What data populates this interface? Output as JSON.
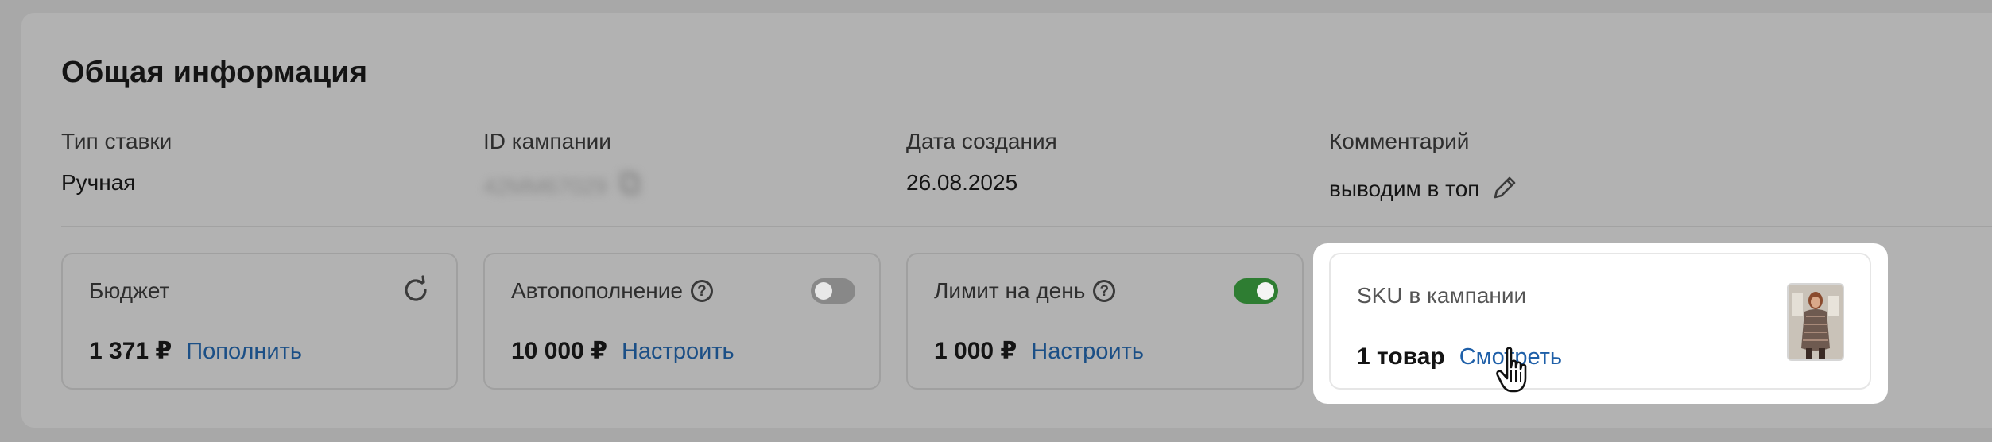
{
  "section": {
    "title": "Общая информация"
  },
  "info": [
    {
      "label": "Тип ставки",
      "value": "Ручная"
    },
    {
      "label": "ID кампании",
      "value": "42MM67029"
    },
    {
      "label": "Дата создания",
      "value": "26.08.2025"
    },
    {
      "label": "Комментарий",
      "value": "выводим в топ"
    }
  ],
  "cards": {
    "budget": {
      "label": "Бюджет",
      "amount": "1 371 ₽",
      "action": "Пополнить"
    },
    "autotopup": {
      "label": "Автопополнение",
      "amount": "10 000 ₽",
      "action": "Настроить",
      "toggle_on": false
    },
    "daily_limit": {
      "label": "Лимит на день",
      "amount": "1 000 ₽",
      "action": "Настроить",
      "toggle_on": true
    },
    "sku": {
      "label": "SKU в кампании",
      "amount": "1 товар",
      "action": "Смотреть"
    }
  },
  "icons": {
    "refresh": "refresh-icon",
    "help": "help-circle-icon",
    "edit": "pencil-icon",
    "copy": "copy-icon",
    "cursor": "hand-pointer-icon"
  },
  "colors": {
    "link": "#1e5fa8",
    "toggle_on": "#2e7d32",
    "toggle_off": "#888888"
  }
}
